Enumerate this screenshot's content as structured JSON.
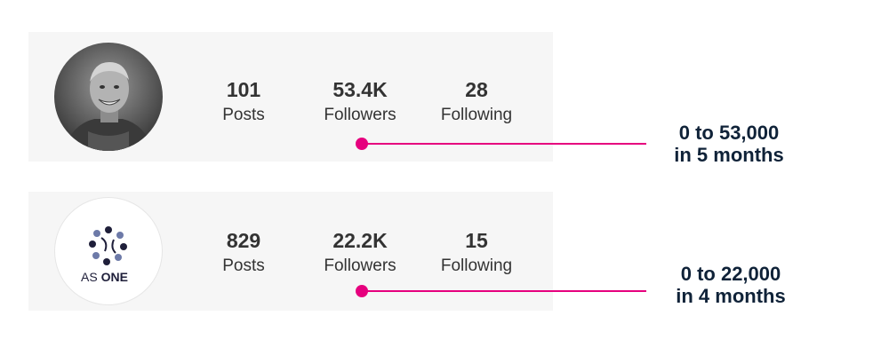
{
  "profiles": [
    {
      "stats": {
        "posts": {
          "value": "101",
          "label": "Posts"
        },
        "followers": {
          "value": "53.4K",
          "label": "Followers"
        },
        "following": {
          "value": "28",
          "label": "Following"
        }
      },
      "annotation": {
        "line1": "0 to 53,000",
        "line2": "in 5 months"
      }
    },
    {
      "logo_text": {
        "part1": "AS ",
        "part2": "ONE"
      },
      "stats": {
        "posts": {
          "value": "829",
          "label": "Posts"
        },
        "followers": {
          "value": "22.2K",
          "label": "Followers"
        },
        "following": {
          "value": "15",
          "label": "Following"
        }
      },
      "annotation": {
        "line1": "0 to 22,000",
        "line2": "in 4 months"
      }
    }
  ],
  "colors": {
    "connector": "#e6007e",
    "annotation_text": "#0f2238",
    "card_bg": "#f6f6f6"
  }
}
